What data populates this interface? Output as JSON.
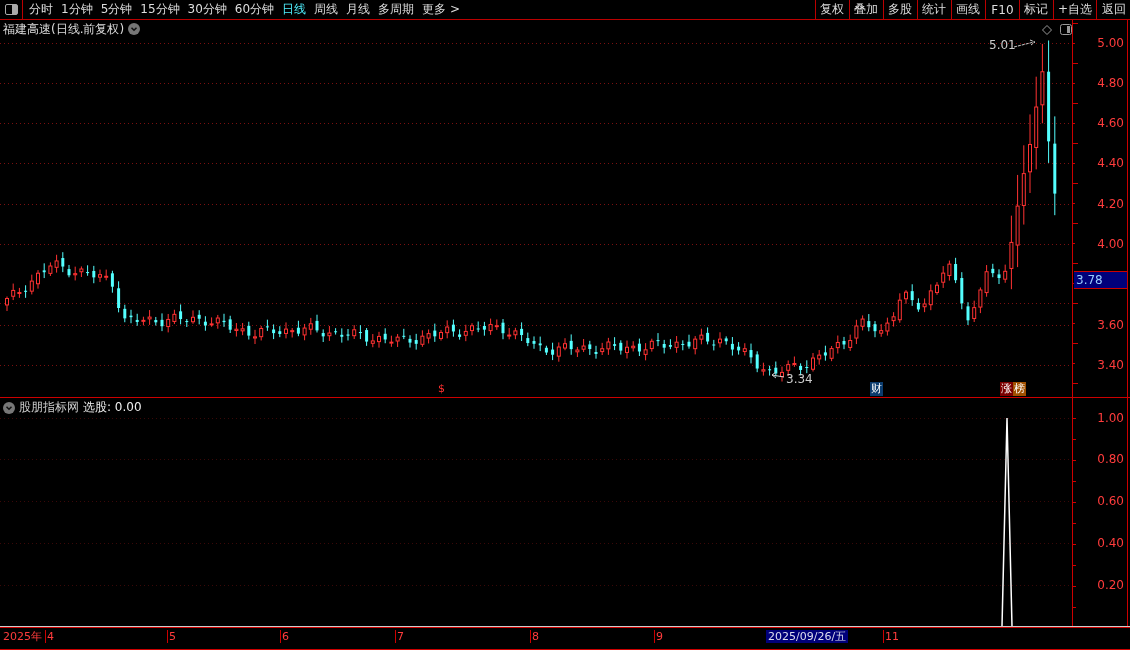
{
  "toolbar": {
    "periods": [
      {
        "label": "分时",
        "selected": false
      },
      {
        "label": "1分钟",
        "selected": false
      },
      {
        "label": "5分钟",
        "selected": false
      },
      {
        "label": "15分钟",
        "selected": false
      },
      {
        "label": "30分钟",
        "selected": false
      },
      {
        "label": "60分钟",
        "selected": false
      },
      {
        "label": "日线",
        "selected": true
      },
      {
        "label": "周线",
        "selected": false
      },
      {
        "label": "月线",
        "selected": false
      },
      {
        "label": "多周期",
        "selected": false
      },
      {
        "label": "更多 >",
        "selected": false
      }
    ],
    "actions": [
      "复权",
      "叠加",
      "多股",
      "统计",
      "画线",
      "F10",
      "标记",
      "+自选",
      "返回"
    ]
  },
  "main_chart": {
    "title": "福建高速(日线.前复权)",
    "y_ticks": [
      "5.00",
      "4.80",
      "4.60",
      "4.40",
      "4.20",
      "4.00",
      "3.60",
      "3.40"
    ],
    "current_price": "3.78",
    "high_label": "5.01",
    "low_label": "3.34",
    "event_markers": [
      {
        "kind": "dividend",
        "text": "$"
      },
      {
        "kind": "finance",
        "text": "财"
      },
      {
        "kind": "limit_up",
        "text": "涨"
      },
      {
        "kind": "ranking",
        "text": "榜"
      }
    ]
  },
  "indicator": {
    "name": "股朋指标网",
    "readout": "选股: 0.00",
    "y_ticks": [
      "1.00",
      "0.80",
      "0.60",
      "0.40",
      "0.20"
    ]
  },
  "date_axis": {
    "year": "2025年",
    "months": [
      "4",
      "5",
      "6",
      "7",
      "8",
      "9",
      "11"
    ],
    "cursor_date": "2025/09/26/五"
  }
}
